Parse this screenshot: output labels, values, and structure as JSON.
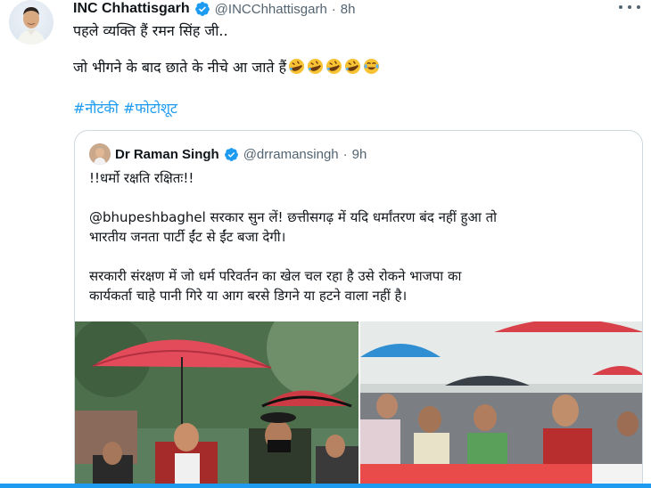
{
  "tweet": {
    "author_name": "INC Chhattisgarh",
    "handle": "@INCChhattisgarh",
    "separator": "·",
    "time": "8h",
    "line1": "पहले व्यक्ति हैं रमन सिंह जी..",
    "line2": "जो भीगने के बाद छाते के नीचे आ जाते हैं",
    "hashtags": [
      "#नौटंकी",
      "#फोटोशूट"
    ],
    "emojis": [
      "rolling-on-floor-laughing",
      "rolling-on-floor-laughing",
      "rolling-on-floor-laughing",
      "rolling-on-floor-laughing",
      "tears-of-joy"
    ]
  },
  "quoted": {
    "author_name": "Dr Raman Singh",
    "handle": "@drramansingh",
    "separator": "·",
    "time": "9h",
    "line1": "!!धर्मो रक्षति रक्षितः!!",
    "line2": "@bhupeshbaghel सरकार सुन लें! छत्तीसगढ़ में यदि धर्मांतरण बंद नहीं हुआ तो",
    "line3": "भारतीय जनता पार्टी ईंट से ईंट बजा देगी।",
    "line4": "सरकारी संरक्षण में जो धर्म परिवर्तन का खेल चल रहा है उसे रोकने भाजपा का",
    "line5": "कार्यकर्ता चाहे पानी गिरे या आग बरसे डिगने या हटने वाला नहीं है।"
  },
  "colors": {
    "accent": "#1d9bf0",
    "text": "#0f1419",
    "secondary": "#536471",
    "border": "#cfd9de",
    "verified": "#1d9bf0"
  },
  "icons": {
    "verified": "verified-badge-icon",
    "more": "more-options-icon"
  }
}
